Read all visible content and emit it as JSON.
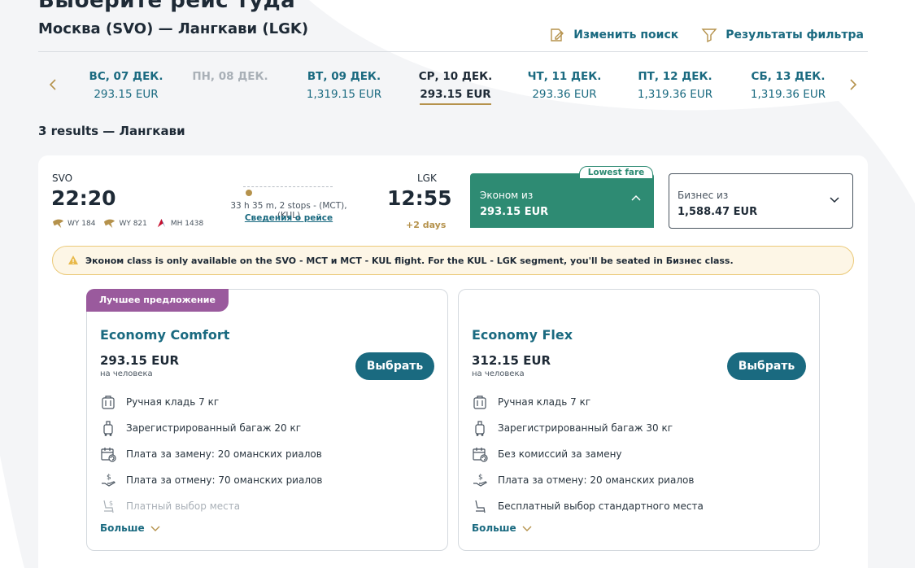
{
  "header": {
    "cut_heading": "Выберите рейс туда",
    "route_title": "Москва (SVO) — Лангкави (LGK)",
    "change_search_label": "Изменить поиск",
    "filter_results_label": "Результаты фильтра"
  },
  "date_strip": {
    "dates": [
      {
        "label": "ВС, 07 ДЕК.",
        "price": "293.15 EUR",
        "state": "available"
      },
      {
        "label": "ПН, 08 ДЕК.",
        "price": "",
        "state": "disabled"
      },
      {
        "label": "ВТ, 09 ДЕК.",
        "price": "1,319.15 EUR",
        "state": "available"
      },
      {
        "label": "СР, 10 ДЕК.",
        "price": "293.15 EUR",
        "state": "selected"
      },
      {
        "label": "ЧТ, 11 ДЕК.",
        "price": "293.36 EUR",
        "state": "available"
      },
      {
        "label": "ПТ, 12 ДЕК.",
        "price": "1,319.36 EUR",
        "state": "available"
      },
      {
        "label": "СБ, 13 ДЕК.",
        "price": "1,319.36 EUR",
        "state": "available"
      }
    ],
    "prev_icon": "chevron-left-icon",
    "next_icon": "chevron-right-icon"
  },
  "results": {
    "count_label": "3 results — Лангкави"
  },
  "flight": {
    "departure": {
      "code": "SVO",
      "time": "22:20"
    },
    "arrival": {
      "code": "LGK",
      "time": "12:55",
      "plus_days": "+2 days"
    },
    "duration_text": "33 h 35 m, 2 stops - (MCT), (KUL)",
    "details_link": "Сведения о рейсе",
    "carriers": [
      {
        "code": "WY 184"
      },
      {
        "code": "WY 821"
      },
      {
        "code": "MH 1438"
      }
    ],
    "fares": {
      "economy": {
        "label": "Эконом из",
        "price": "293.15 EUR",
        "badge": "Lowest fare"
      },
      "business": {
        "label": "Бизнес из",
        "price": "1,588.47 EUR"
      }
    },
    "notice": "Эконом class is only available on the SVO - MCT и MCT - KUL flight. For the KUL - LGK segment, you'll be seated in Бизнес class."
  },
  "fare_options": [
    {
      "badge": "Лучшее предложение",
      "title": "Economy Comfort",
      "price": "293.15 EUR",
      "per_person": "на человека",
      "select_label": "Выбрать",
      "features": [
        {
          "icon": "carry-on-bag-icon",
          "text": "Ручная кладь 7 кг",
          "muted": false
        },
        {
          "icon": "checked-bag-icon",
          "text": "Зарегистрированный багаж 20 кг",
          "muted": false
        },
        {
          "icon": "calendar-change-icon",
          "text": "Плата за замену: 20 оманских риалов",
          "muted": false
        },
        {
          "icon": "refund-hand-icon",
          "text": "Плата за отмену: 70 оманских риалов",
          "muted": false
        },
        {
          "icon": "seat-paid-icon",
          "text": "Платный выбор места",
          "muted": true
        }
      ],
      "more_label": "Больше"
    },
    {
      "badge": "",
      "title": "Economy Flex",
      "price": "312.15 EUR",
      "per_person": "на человека",
      "select_label": "Выбрать",
      "features": [
        {
          "icon": "carry-on-bag-icon",
          "text": "Ручная кладь 7 кг",
          "muted": false
        },
        {
          "icon": "checked-bag-icon",
          "text": "Зарегистрированный багаж 30 кг",
          "muted": false
        },
        {
          "icon": "calendar-change-icon",
          "text": "Без комиссий за замену",
          "muted": false
        },
        {
          "icon": "refund-hand-icon",
          "text": "Плата за отмену: 20 оманских риалов",
          "muted": false
        },
        {
          "icon": "seat-icon",
          "text": "Бесплатный выбор стандартного места",
          "muted": false
        }
      ],
      "more_label": "Больше"
    }
  ],
  "colors": {
    "primary_teal": "#1a6a80",
    "economy_green": "#2e8b73",
    "gold_accent": "#b5924c",
    "best_offer_purple": "#9a5a9d",
    "notice_bg": "#fdf6e6"
  }
}
